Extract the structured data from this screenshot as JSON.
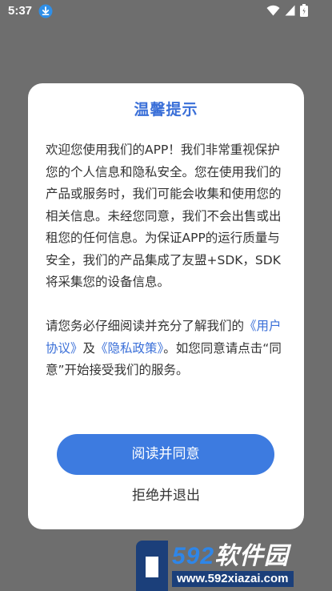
{
  "status_bar": {
    "time": "5:37",
    "icons": [
      "download-icon",
      "wifi-icon",
      "signal-icon",
      "battery-icon"
    ]
  },
  "dialog": {
    "title": "温馨提示",
    "para1": "欢迎您使用我们的APP！我们非常重视保护您的个人信息和隐私安全。您在使用我们的产品或服务时，我们可能会收集和使用您的相关信息。未经您同意，我们不会出售或出租您的任何信息。为保证APP的运行质量与安全，我们的产品集成了友盟+SDK，SDK将采集您的设备信息。",
    "para2_prefix": "请您务必仔细阅读并充分了解我们的",
    "user_agreement_link": "《用户协议》",
    "and_text": "及",
    "privacy_policy_link": "《隐私政策》",
    "para2_suffix": "。如您同意请点击“同意”开始接受我们的服务。",
    "agree_label": "阅读并同意",
    "reject_label": "拒绝并退出"
  },
  "watermark": {
    "brand_number": "592",
    "brand_text": "软件园",
    "url": "www.592xiazai.com"
  },
  "colors": {
    "accent": "#3d7be0",
    "title": "#3a6fd8",
    "overlay": "#6e6e6e"
  }
}
